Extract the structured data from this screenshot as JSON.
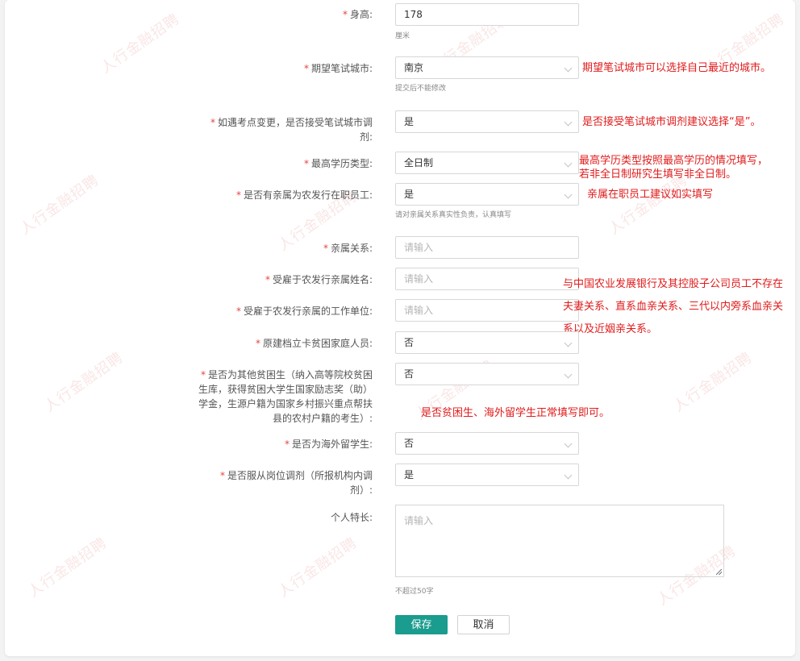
{
  "watermark": "人行金融招聘",
  "form": {
    "height": {
      "label": "身高:",
      "value": "178",
      "hint": "厘米"
    },
    "exam_city": {
      "label": "期望笔试城市:",
      "value": "南京",
      "hint": "提交后不能修改"
    },
    "accept_adjust": {
      "label_line1": "如遇考点变更，是否接受笔试城市调",
      "label_line2": "剂:",
      "value": "是"
    },
    "edu_type": {
      "label": "最高学历类型:",
      "value": "全日制"
    },
    "relative_employee": {
      "label": "是否有亲属为农发行在职员工:",
      "value": "是",
      "hint": "请对亲属关系真实性负责，认真填写"
    },
    "relation": {
      "label": "亲属关系:",
      "placeholder": "请输入"
    },
    "relative_name": {
      "label": "受雇于农发行亲属姓名:",
      "placeholder": "请输入"
    },
    "relative_unit": {
      "label": "受雇于农发行亲属的工作单位:",
      "placeholder": "请输入"
    },
    "poverty_family": {
      "label": "原建档立卡贫困家庭人员:",
      "value": "否"
    },
    "other_poor": {
      "label_line1": "是否为其他贫困生（纳入高等院校贫困",
      "label_line2": "生库，获得贫困大学生国家励志奖（助）",
      "label_line3": "学金，生源户籍为国家乡村振兴重点帮扶",
      "label_line4": "县的农村户籍的考生）:",
      "value": "否"
    },
    "overseas": {
      "label": "是否为海外留学生:",
      "value": "否"
    },
    "obey_adjust": {
      "label_line1": "是否服从岗位调剂（所报机构内调",
      "label_line2": "剂）:",
      "value": "是"
    },
    "specialty": {
      "label": "个人特长:",
      "placeholder": "请输入",
      "hint": "不超过50字"
    }
  },
  "notes": {
    "city": "期望笔试城市可以选择自己最近的城市。",
    "adjust": "是否接受笔试城市调剂建议选择“是”。",
    "edu_line1": "最高学历类型按照最高学历的情况填写，",
    "edu_line2": "若非全日制研究生填写非全日制。",
    "relative": "亲属在职员工建议如实填写",
    "relation_line1": "与中国农业发展银行及其控股子公司员工不存在",
    "relation_line2": "夫妻关系、直系血亲关系、三代以内旁系血亲关",
    "relation_line3": "系以及近姻亲关系。",
    "poor": "是否贫困生、海外留学生正常填写即可。"
  },
  "buttons": {
    "save": "保存",
    "cancel": "取消"
  },
  "colors": {
    "primary": "#1a9c8e",
    "required": "#e2473f",
    "note": "#e01b1b"
  }
}
